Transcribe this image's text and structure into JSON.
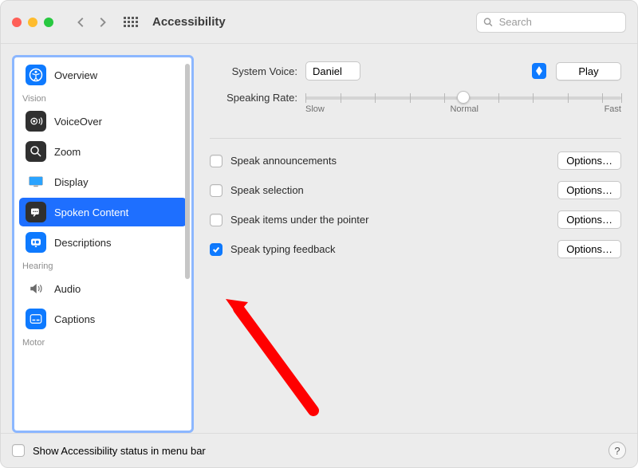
{
  "titlebar": {
    "title": "Accessibility",
    "search_placeholder": "Search"
  },
  "sidebar": {
    "items": [
      {
        "label": "Overview",
        "icon": "accessibility"
      },
      {
        "section": "Vision"
      },
      {
        "label": "VoiceOver",
        "icon": "voiceover"
      },
      {
        "label": "Zoom",
        "icon": "zoom"
      },
      {
        "label": "Display",
        "icon": "display"
      },
      {
        "label": "Spoken Content",
        "icon": "spoken",
        "selected": true
      },
      {
        "label": "Descriptions",
        "icon": "descriptions"
      },
      {
        "section": "Hearing"
      },
      {
        "label": "Audio",
        "icon": "audio"
      },
      {
        "label": "Captions",
        "icon": "captions"
      },
      {
        "section": "Motor"
      }
    ]
  },
  "content": {
    "system_voice_label": "System Voice:",
    "system_voice_value": "Daniel",
    "play_label": "Play",
    "speaking_rate_label": "Speaking Rate:",
    "rate_slow": "Slow",
    "rate_normal": "Normal",
    "rate_fast": "Fast",
    "options": [
      {
        "label": "Speak announcements",
        "checked": false,
        "has_options": true
      },
      {
        "label": "Speak selection",
        "checked": false,
        "has_options": true
      },
      {
        "label": "Speak items under the pointer",
        "checked": false,
        "has_options": true
      },
      {
        "label": "Speak typing feedback",
        "checked": true,
        "has_options": true
      }
    ],
    "options_button_label": "Options…"
  },
  "footer": {
    "status_checkbox_label": "Show Accessibility status in menu bar",
    "status_checked": false,
    "help": "?"
  }
}
